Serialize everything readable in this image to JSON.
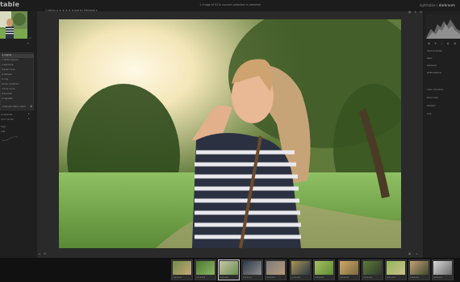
{
  "app": {
    "title": "table",
    "center_message": "1 image of 51 in current collection is selected",
    "rating_filter": "1 rating ≥ ★ ★ ★ ★ ★",
    "sort_label": "sort by  filename ▾",
    "view_modes": [
      "lighttable",
      "darkroom"
    ],
    "view_separator": "|"
  },
  "left_panel": {
    "history_items": [
      "0 original",
      "1 white balance",
      "2 exposure",
      "3 base curve",
      "4 sharpen",
      "5 crop",
      "6 lens correction",
      "7 tone curve",
      "8 denoise",
      "9 vignette"
    ],
    "history_selected": 0,
    "history_bottom_label": "compress history stack",
    "section_labels": [
      "snapshots",
      "color picker"
    ],
    "tag_labels": [
      "tags",
      "edit"
    ]
  },
  "right_panel": {
    "rows": [
      {
        "label": "more modules"
      },
      {
        "label": "basic"
      },
      {
        "label": "exposure"
      },
      {
        "label": "white balance"
      },
      {
        "label": "color correction"
      },
      {
        "label": "tone curve"
      },
      {
        "label": "sharpen"
      },
      {
        "label": "crop"
      }
    ]
  },
  "filmstrip": {
    "thumbnails": [
      {
        "id": "t1",
        "stars": "★★★★★"
      },
      {
        "id": "t2",
        "stars": "★★★★★"
      },
      {
        "id": "t3",
        "stars": "★★★★★"
      },
      {
        "id": "t4",
        "stars": "★★★★★"
      },
      {
        "id": "t5",
        "stars": "★★★★★"
      },
      {
        "id": "t6",
        "stars": "★★★★★"
      },
      {
        "id": "t7",
        "stars": "★★★★★"
      },
      {
        "id": "t8",
        "stars": "★★★★★"
      },
      {
        "id": "t9",
        "stars": "★★★★★"
      },
      {
        "id": "t10",
        "stars": "★★★★★"
      },
      {
        "id": "t11",
        "stars": "★★★★★"
      },
      {
        "id": "t12",
        "stars": "★★★★★"
      }
    ],
    "selected_index": 2
  },
  "icons": {
    "top_right": [
      "grid-icon",
      "star-icon",
      "settings-icon"
    ],
    "bottom": [
      "left-expand-icon",
      "gear-icon",
      "right-expand-icon",
      "info-icon"
    ]
  }
}
